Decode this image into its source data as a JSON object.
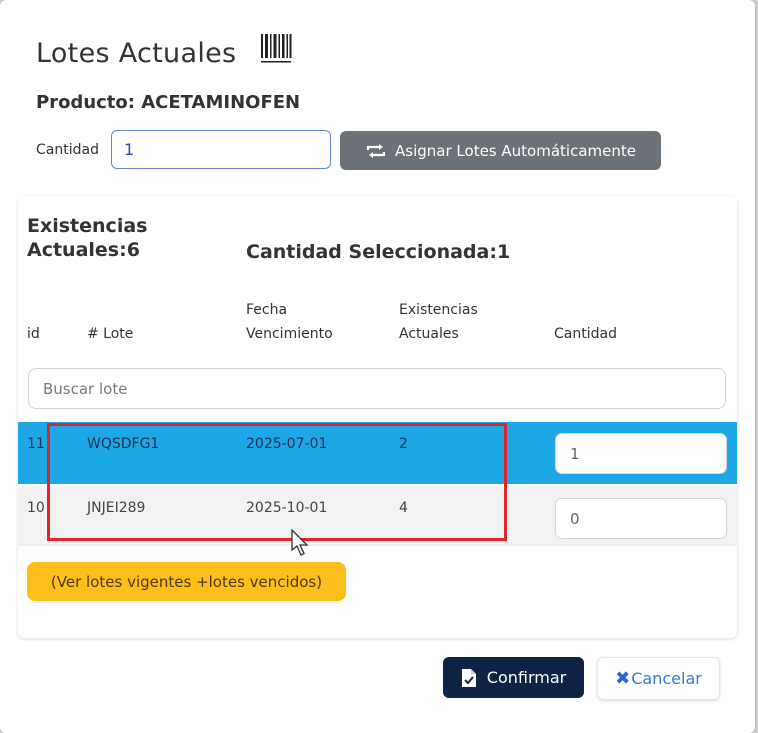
{
  "modal": {
    "title": "Lotes Actuales",
    "product_label": "Producto: ACETAMINOFEN"
  },
  "quantity": {
    "label": "Cantidad",
    "value": "1"
  },
  "auto_assign_button": {
    "label": "Asignar Lotes Automáticamente",
    "icon": "repeat-icon"
  },
  "summary": {
    "stock_label": "Existencias Actuales:6",
    "selected_label": "Cantidad Seleccionada:1"
  },
  "table": {
    "headers": {
      "id": "id",
      "lote": "# Lote",
      "fecha_line1": "Fecha",
      "fecha_line2": "Vencimiento",
      "exist_line1": "Existencias",
      "exist_line2": "Actuales",
      "cantidad": "Cantidad"
    },
    "search_placeholder": "Buscar lote",
    "rows": [
      {
        "id": "11",
        "lote": "WQSDFG1",
        "fecha": "2025-07-01",
        "existencias": "2",
        "cantidad": "1"
      },
      {
        "id": "10",
        "lote": "JNJEI289",
        "fecha": "2025-10-01",
        "existencias": "4",
        "cantidad": "0"
      }
    ]
  },
  "see_lots_button": {
    "label": "(Ver lotes vigentes +lotes vencidos)"
  },
  "footer": {
    "confirm_label": "Confirmar",
    "cancel_label": "Cancelar",
    "confirm_icon": "document-check-icon",
    "cancel_icon": "x-icon"
  },
  "colors": {
    "selected_row": "#1ea7e7",
    "confirm_bg": "#0e2346",
    "secondary_button": "#6c7177",
    "warning_button": "#ffbe1a",
    "highlight_box": "#e0252f"
  }
}
